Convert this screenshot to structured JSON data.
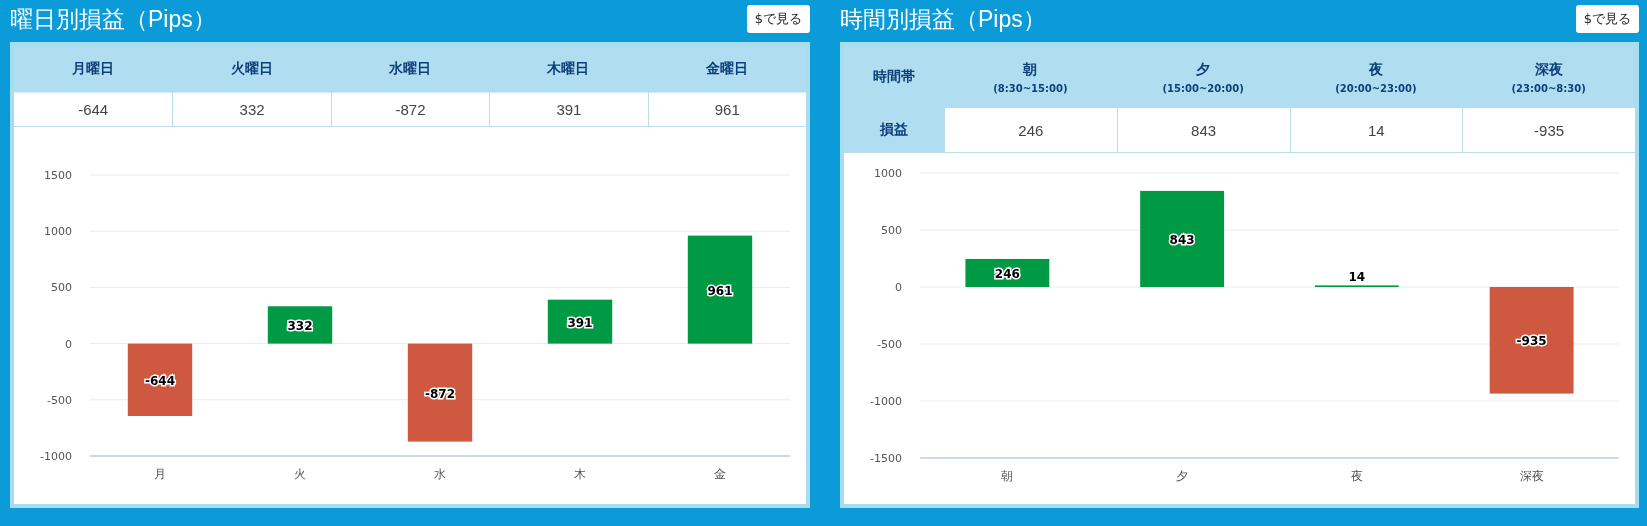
{
  "panels": [
    {
      "kind": "weekday",
      "title": "曜日別損益（Pips）",
      "button": "$で見る",
      "table": {
        "columns": [
          "月曜日",
          "火曜日",
          "水曜日",
          "木曜日",
          "金曜日"
        ],
        "values": [
          "-644",
          "332",
          "-872",
          "391",
          "961"
        ]
      },
      "chart_data": {
        "type": "bar",
        "categories": [
          "月",
          "火",
          "水",
          "木",
          "金"
        ],
        "series": [
          {
            "color": "#009944",
            "values": [
              null,
              332,
              null,
              391,
              961
            ]
          },
          {
            "color": "#cf5840",
            "values": [
              -644,
              null,
              -872,
              null,
              null
            ]
          }
        ],
        "grid": true,
        "ylim": [
          -1000,
          1500
        ],
        "yticks": [
          -1000,
          -500,
          0,
          500,
          1000,
          1500
        ],
        "value_labels": [
          "-644",
          "332",
          "-872",
          "391",
          "961"
        ]
      }
    },
    {
      "kind": "timeband",
      "title": "時間別損益（Pips）",
      "button": "$で見る",
      "table": {
        "row_headers": [
          "時間帯",
          "損益"
        ],
        "columns": [
          {
            "label": "朝",
            "range": "(8:30~15:00)"
          },
          {
            "label": "夕",
            "range": "(15:00~20:00)"
          },
          {
            "label": "夜",
            "range": "(20:00~23:00)"
          },
          {
            "label": "深夜",
            "range": "(23:00~8:30)"
          }
        ],
        "values": [
          "246",
          "843",
          "14",
          "-935"
        ]
      },
      "chart_data": {
        "type": "bar",
        "categories": [
          "朝",
          "夕",
          "夜",
          "深夜"
        ],
        "series": [
          {
            "color": "#009944",
            "values": [
              246,
              843,
              14,
              null
            ]
          },
          {
            "color": "#cf5840",
            "values": [
              null,
              null,
              null,
              -935
            ]
          }
        ],
        "grid": true,
        "ylim": [
          -1500,
          1000
        ],
        "yticks": [
          -1500,
          -1000,
          -500,
          0,
          500,
          1000
        ],
        "value_labels": [
          "246",
          "843",
          "14",
          "-935"
        ]
      }
    }
  ]
}
